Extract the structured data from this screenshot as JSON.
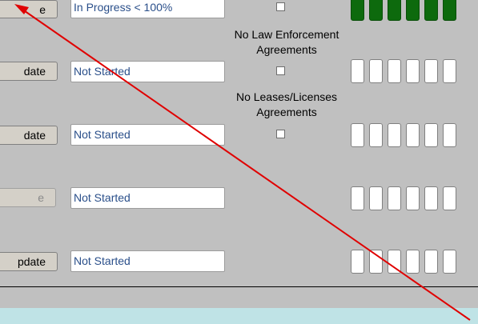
{
  "rows": [
    {
      "button_label": "e",
      "button_disabled": false,
      "status": "In Progress < 100%",
      "progress_cells_filled": 6
    },
    {
      "button_label": "date",
      "button_disabled": false,
      "status": "Not Started",
      "progress_cells_filled": 0
    },
    {
      "button_label": "date",
      "button_disabled": false,
      "status": "Not Started",
      "progress_cells_filled": 0
    },
    {
      "button_label": "e",
      "button_disabled": true,
      "status": "Not Started",
      "progress_cells_filled": 0
    },
    {
      "button_label": "pdate",
      "button_disabled": false,
      "status": "Not Started",
      "progress_cells_filled": 0
    }
  ],
  "agreements": [
    {
      "label": "No Law Enforcement Agreements",
      "checked": false
    },
    {
      "label": "No Leases/Licenses Agreements",
      "checked": false
    }
  ],
  "progress_cells_total": 6,
  "colors": {
    "filled_cell": "#0d6a0d",
    "annotation_arrow": "#e00000",
    "bottom_band": "#bfe3e6"
  }
}
